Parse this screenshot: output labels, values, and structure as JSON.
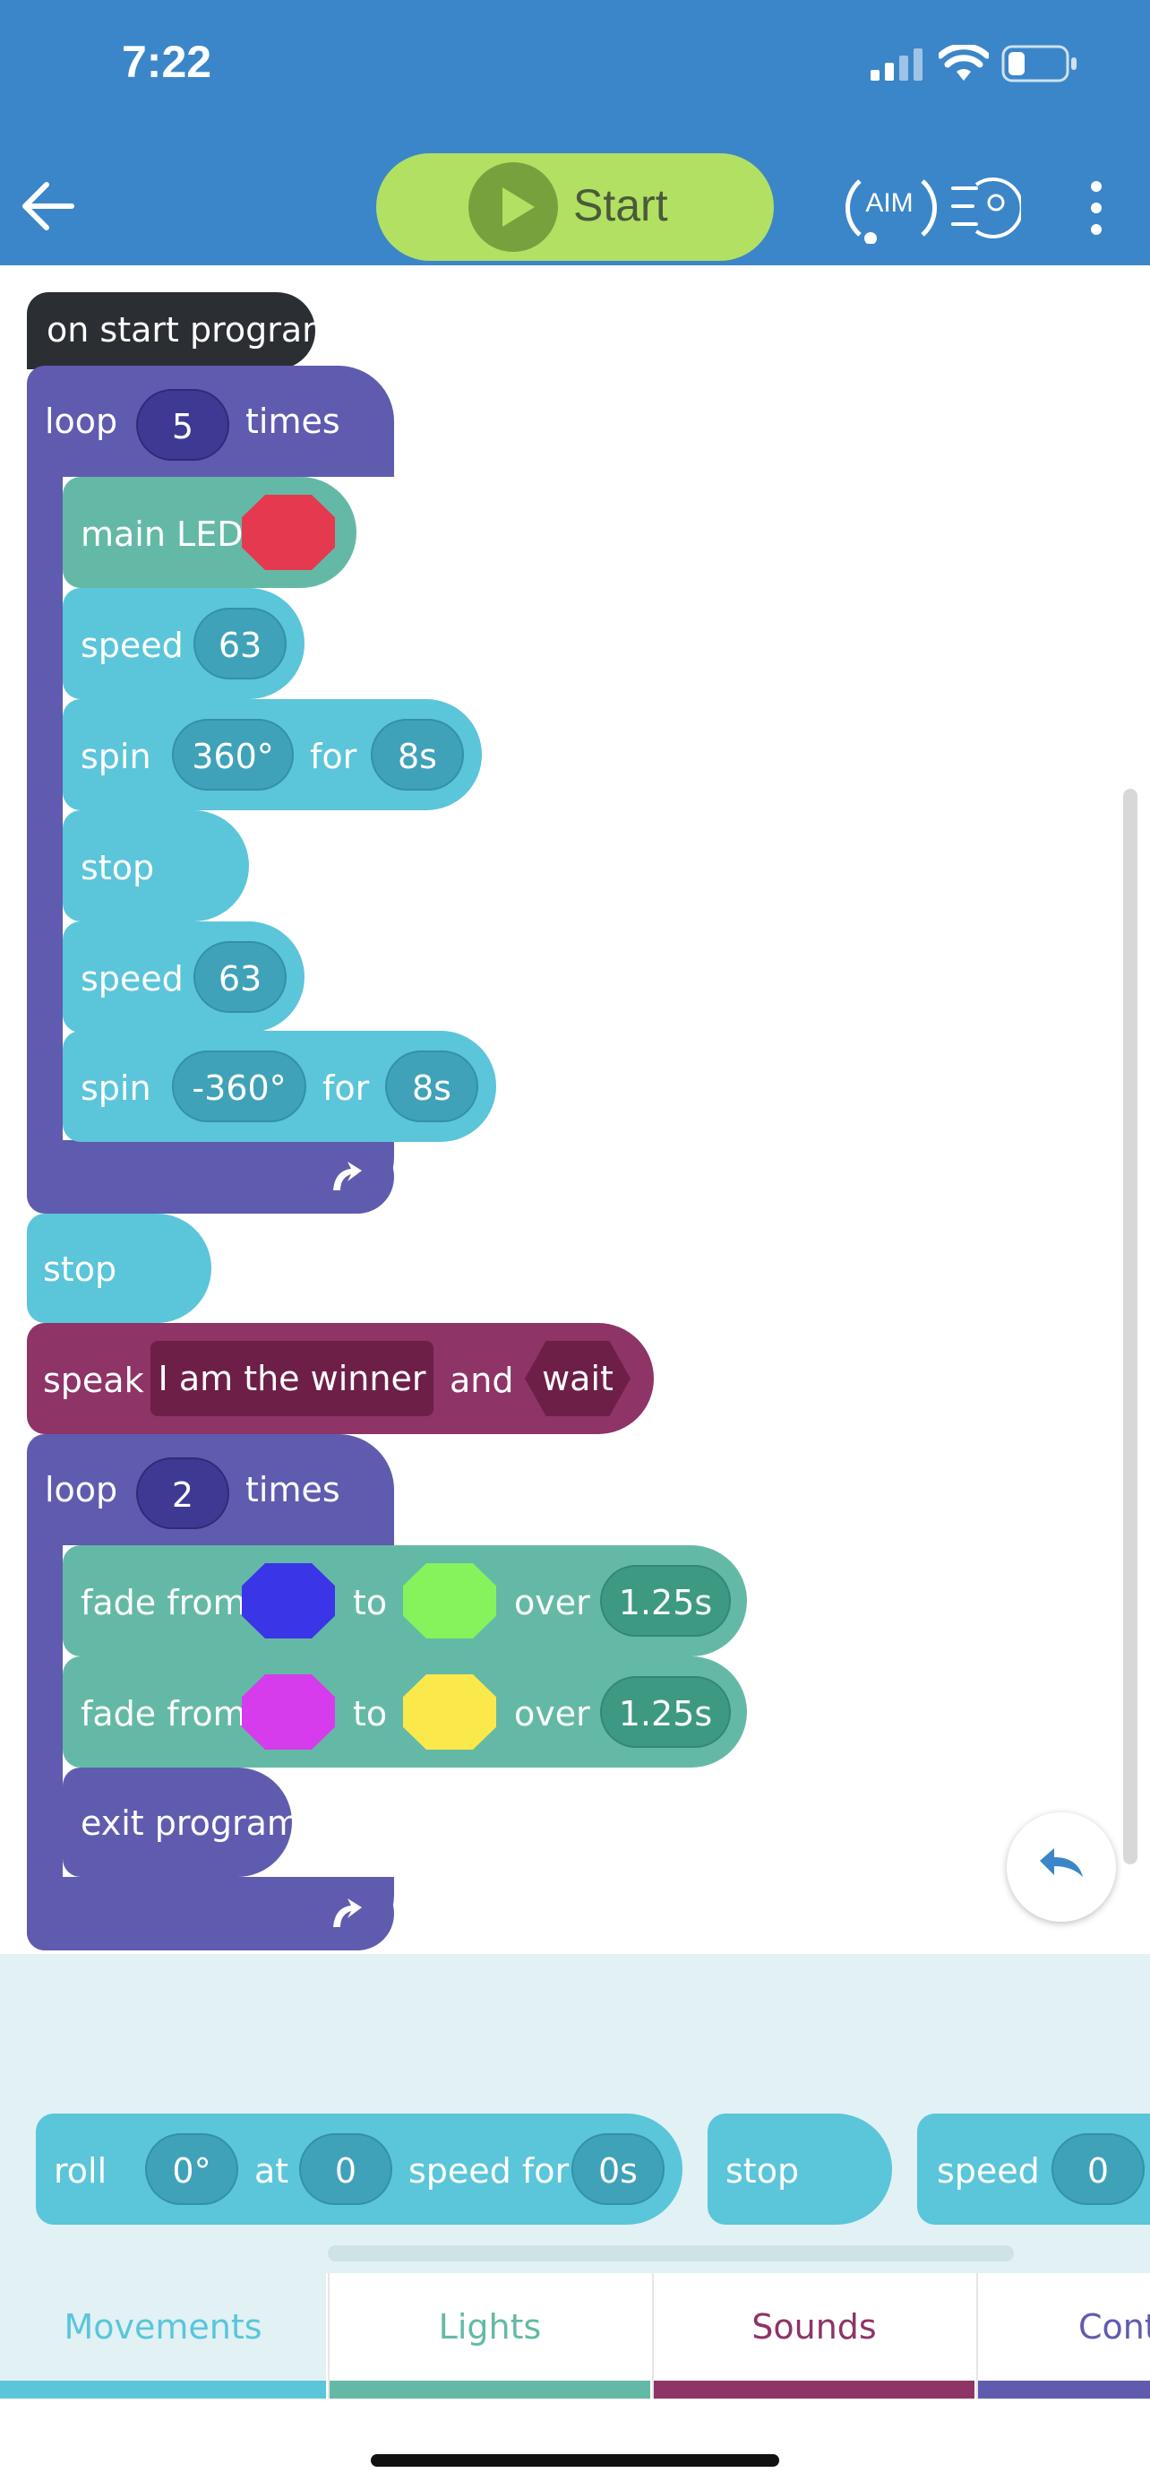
{
  "status": {
    "time": "7:22"
  },
  "header": {
    "back_icon": "arrow-left-icon",
    "start_label": "Start",
    "aim_label": "AIM",
    "drive_icon": "drive-speed-icon",
    "more_icon": "more-vertical-icon"
  },
  "program": {
    "start_block": "on start program",
    "loop1": {
      "label": "loop",
      "count": "5",
      "suffix": "times"
    },
    "main_led": {
      "label": "main LED",
      "color": "#e53950"
    },
    "speed1": {
      "label": "speed",
      "value": "63"
    },
    "spin1": {
      "label": "spin",
      "angle": "360°",
      "for": "for",
      "duration": "8s"
    },
    "stop1": "stop",
    "speed2": {
      "label": "speed",
      "value": "63"
    },
    "spin2": {
      "label": "spin",
      "angle": "-360°",
      "for": "for",
      "duration": "8s"
    },
    "stop2": "stop",
    "speak": {
      "label": "speak",
      "text": "I am the winner",
      "and": "and",
      "wait": "wait"
    },
    "loop2": {
      "label": "loop",
      "count": "2",
      "suffix": "times"
    },
    "fade1": {
      "label": "fade from",
      "from_color": "#3b35e8",
      "to": "to",
      "to_color": "#86f25c",
      "over": "over",
      "duration": "1.25s"
    },
    "fade2": {
      "label": "fade from",
      "from_color": "#d63cec",
      "to": "to",
      "to_color": "#fbe94c",
      "over": "over",
      "duration": "1.25s"
    },
    "exit": "exit program"
  },
  "palette": {
    "roll": {
      "label": "roll",
      "angle": "0°",
      "at": "at",
      "speed": "0",
      "speed_for": "speed for",
      "duration": "0s"
    },
    "stop": "stop",
    "speed": {
      "label": "speed",
      "value": "0"
    }
  },
  "tabs": [
    {
      "label": "Movements",
      "color": "#5bc5da"
    },
    {
      "label": "Lights",
      "color": "#64b9a6"
    },
    {
      "label": "Sounds",
      "color": "#8e3467"
    },
    {
      "label": "Cont",
      "color": "#5f5caf"
    }
  ]
}
